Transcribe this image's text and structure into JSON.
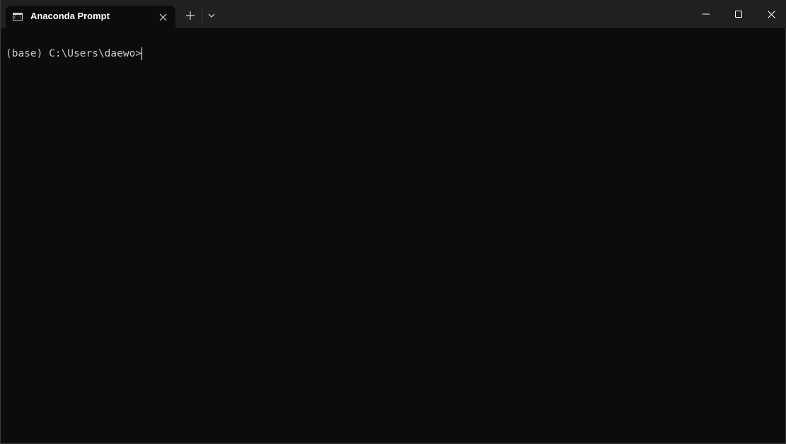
{
  "window": {
    "tab_title": "Anaconda Prompt",
    "tab_icon": "console-icon",
    "tab_icon_glyph": "C:\\"
  },
  "titlebar": {
    "new_tab_icon": "plus-icon",
    "dropdown_icon": "chevron-down-icon",
    "minimize_icon": "minimize-icon",
    "maximize_icon": "maximize-icon",
    "close_icon": "close-icon"
  },
  "terminal": {
    "prompt": "(base) C:\\Users\\daewo>",
    "background": "#0c0c0c",
    "foreground": "#cccccc"
  }
}
